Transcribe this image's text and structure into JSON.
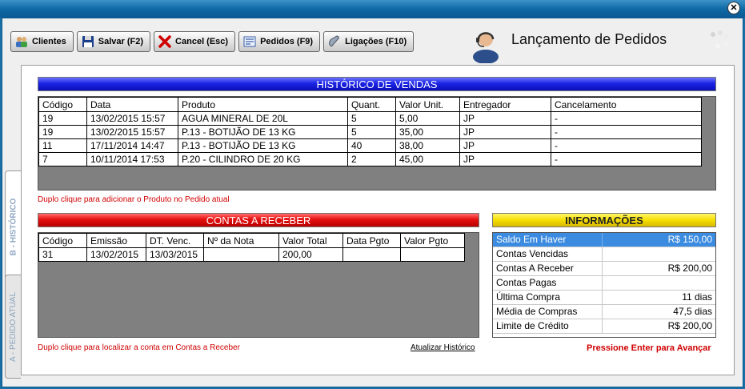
{
  "window": {
    "close_glyph": "✕"
  },
  "toolbar": {
    "clientes": "Clientes",
    "salvar": "Salvar (F2)",
    "cancel": "Cancel (Esc)",
    "pedidos": "Pedidos (F9)",
    "ligacoes": "Ligações (F10)"
  },
  "header": {
    "title": "Lançamento de Pedidos"
  },
  "tabs": {
    "historico": "B - HISTÓRICO",
    "pedido_atual": "A - PEDIDO ATUAL"
  },
  "historico": {
    "title": "HISTÓRICO DE VENDAS",
    "columns": [
      "Código",
      "Data",
      "Produto",
      "Quant.",
      "Valor Unit.",
      "Entregador",
      "Cancelamento"
    ],
    "rows": [
      [
        "19",
        "13/02/2015 15:57",
        "AGUA MINERAL DE 20L",
        "5",
        "5,00",
        "JP",
        "-"
      ],
      [
        "19",
        "13/02/2015 15:57",
        "P.13 - BOTIJÃO DE 13 KG",
        "5",
        "35,00",
        "JP",
        "-"
      ],
      [
        "11",
        "17/11/2014 14:47",
        "P.13 - BOTIJÃO DE 13 KG",
        "40",
        "38,00",
        "JP",
        "-"
      ],
      [
        "7",
        "10/11/2014 17:53",
        "P.20 - CILINDRO DE 20 KG",
        "2",
        "45,00",
        "JP",
        "-"
      ]
    ],
    "hint": "Duplo clique para adicionar o Produto no Pedido atual"
  },
  "contas": {
    "title": "CONTAS A RECEBER",
    "columns": [
      "Código",
      "Emissão",
      "DT. Venc.",
      "Nº da Nota",
      "Valor Total",
      "Data Pgto",
      "Valor Pgto"
    ],
    "rows": [
      [
        "31",
        "13/02/2015",
        "13/03/2015",
        "",
        "200,00",
        "",
        ""
      ]
    ],
    "hint": "Duplo clique para localizar a conta em Contas a Receber",
    "refresh": "Atualizar Histórico"
  },
  "info": {
    "title": "INFORMAÇÕES",
    "rows": [
      {
        "label": "Saldo Em Haver",
        "value": "R$ 150,00"
      },
      {
        "label": "Contas Vencidas",
        "value": ""
      },
      {
        "label": "Contas A Receber",
        "value": "R$ 200,00"
      },
      {
        "label": "Contas Pagas",
        "value": ""
      },
      {
        "label": "Última Compra",
        "value": "11 dias"
      },
      {
        "label": "Média de Compras",
        "value": "47,5 dias"
      },
      {
        "label": "Limite de Crédito",
        "value": "R$ 200,00"
      }
    ],
    "enter_hint": "Pressione Enter para Avançar"
  },
  "colors": {
    "hist_header": "#1c24e6",
    "contas_header": "#e61010",
    "info_header": "#f5de00",
    "hint_red": "#d00000",
    "selection": "#3b8be0"
  }
}
